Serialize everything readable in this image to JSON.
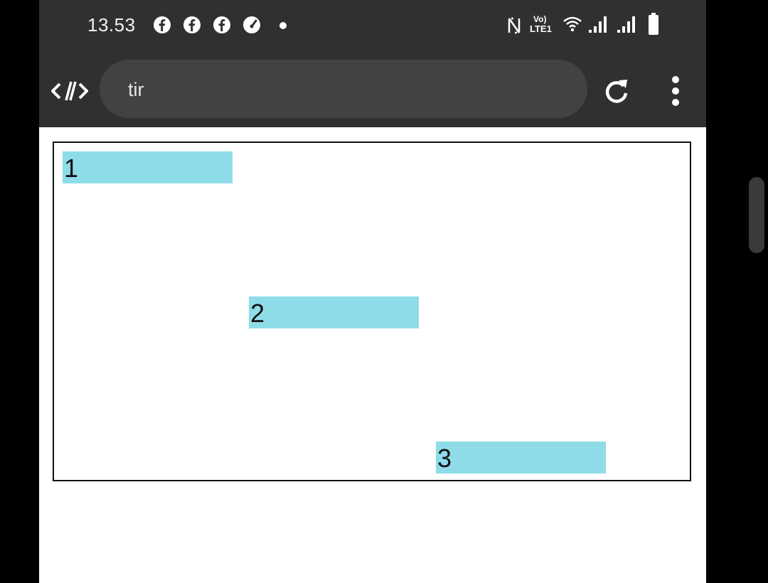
{
  "status_bar": {
    "time": "13.53",
    "notification_icons": [
      "facebook-icon",
      "facebook-icon",
      "facebook-icon",
      "speedometer-icon"
    ],
    "right_icons": [
      "nfc-icon",
      "volte-icon",
      "wifi-icon",
      "signal-icon",
      "signal-icon",
      "battery-icon"
    ],
    "volte_top": "Vo)",
    "volte_bottom": "LTE1"
  },
  "toolbar": {
    "address_text": "tir",
    "reload_icon": "reload-icon",
    "menu_icon": "more-vert-icon"
  },
  "content": {
    "bars": [
      {
        "label": "1"
      },
      {
        "label": "2"
      },
      {
        "label": "3"
      }
    ],
    "bar_color": "#8fdce9"
  },
  "colors": {
    "chrome": "#303030",
    "address_bar": "#424242",
    "background": "#000000"
  }
}
